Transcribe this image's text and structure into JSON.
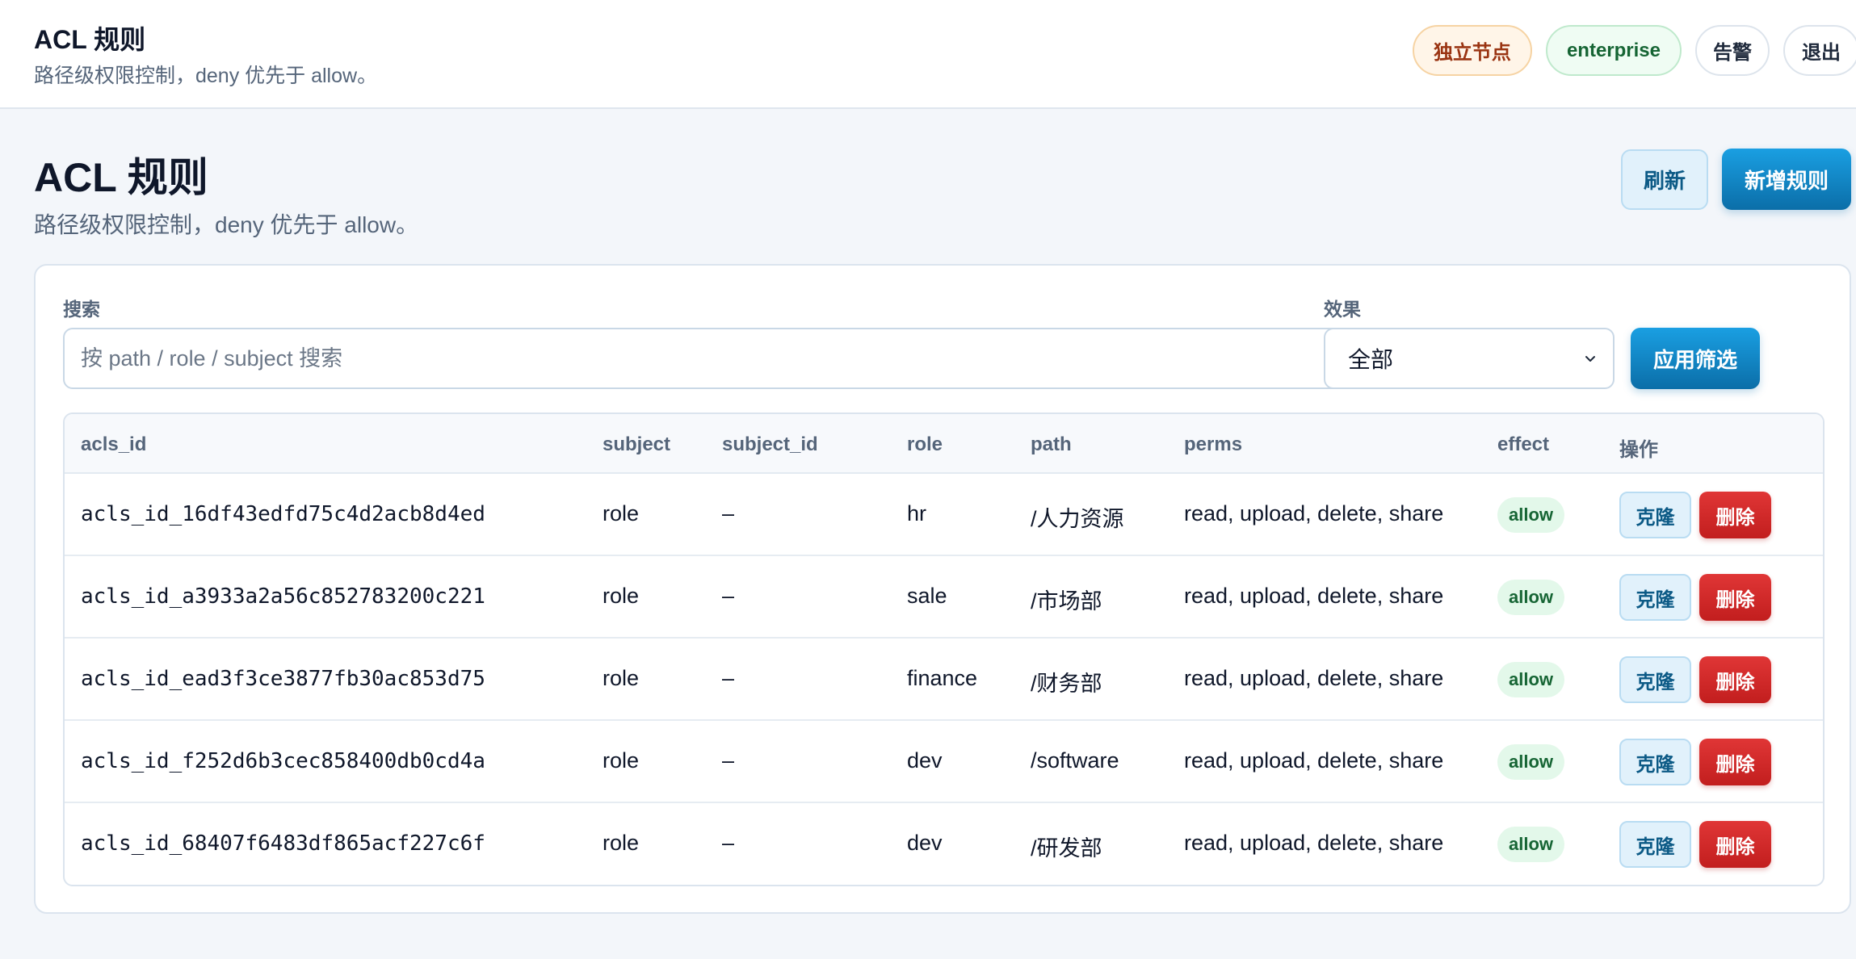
{
  "topbar": {
    "title": "ACL 规则",
    "subtitle": "路径级权限控制，deny 优先于 allow。",
    "badges": {
      "node": "独立节点",
      "edition": "enterprise"
    },
    "alerts_label": "告警",
    "logout_label": "退出"
  },
  "page": {
    "title": "ACL 规则",
    "subtitle": "路径级权限控制，deny 优先于 allow。",
    "refresh_label": "刷新",
    "new_rule_label": "新增规则"
  },
  "filters": {
    "search_label": "搜索",
    "search_placeholder": "按 path / role / subject 搜索",
    "search_value": "",
    "effect_label": "效果",
    "effect_value": "全部",
    "apply_label": "应用筛选"
  },
  "table": {
    "columns": [
      "acls_id",
      "subject",
      "subject_id",
      "role",
      "path",
      "perms",
      "effect",
      "操作"
    ],
    "clone_label": "克隆",
    "delete_label": "删除",
    "rows": [
      {
        "acls_id": "acls_id_16df43edfd75c4d2acb8d4ed",
        "subject": "role",
        "subject_id": "–",
        "role": "hr",
        "path": "/人力资源",
        "perms": "read, upload, delete, share",
        "effect": "allow"
      },
      {
        "acls_id": "acls_id_a3933a2a56c852783200c221",
        "subject": "role",
        "subject_id": "–",
        "role": "sale",
        "path": "/市场部",
        "perms": "read, upload, delete, share",
        "effect": "allow"
      },
      {
        "acls_id": "acls_id_ead3f3ce3877fb30ac853d75",
        "subject": "role",
        "subject_id": "–",
        "role": "finance",
        "path": "/财务部",
        "perms": "read, upload, delete, share",
        "effect": "allow"
      },
      {
        "acls_id": "acls_id_f252d6b3cec858400db0cd4a",
        "subject": "role",
        "subject_id": "–",
        "role": "dev",
        "path": "/software",
        "perms": "read, upload, delete, share",
        "effect": "allow"
      },
      {
        "acls_id": "acls_id_68407f6483df865acf227c6f",
        "subject": "role",
        "subject_id": "–",
        "role": "dev",
        "path": "/研发部",
        "perms": "read, upload, delete, share",
        "effect": "allow"
      }
    ]
  },
  "colors": {
    "primary": "#0ea5e9",
    "danger": "#dc2626",
    "success_bg": "#e3f8ea",
    "success_text": "#166534",
    "warning_bg": "#fff5e8",
    "warning_text": "#9a3412"
  }
}
